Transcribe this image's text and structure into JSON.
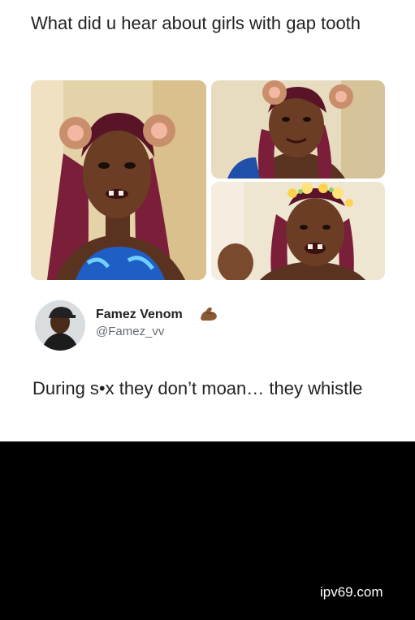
{
  "post": {
    "question": "What did u hear about girls  with gap tooth",
    "reply_author": {
      "display_name": "Famez Venom",
      "handle": "@Famez_vv",
      "name_emoji": "flexed-biceps-icon"
    },
    "reply_text": "During s•x they don’t moan… they whistle"
  },
  "images": [
    {
      "name": "selfie-main",
      "filter": "bear-ears"
    },
    {
      "name": "selfie-top-right",
      "filter": "bear-ears"
    },
    {
      "name": "selfie-bottom-right",
      "filter": "flower-crown"
    }
  ],
  "watermark": "ipv69.com",
  "colors": {
    "background": "#000000",
    "card": "#ffffff",
    "text": "#222222",
    "handle": "#666a70"
  }
}
